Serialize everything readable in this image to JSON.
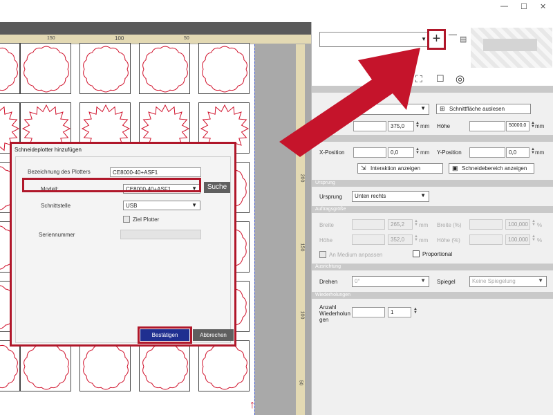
{
  "window": {
    "minimize_icon": "—",
    "maximize_icon": "☐",
    "close_icon": "✕"
  },
  "ruler": {
    "h_labels": [
      "150",
      "100",
      "50"
    ],
    "v_labels": [
      "200",
      "150",
      "100",
      "50"
    ]
  },
  "dialog": {
    "title": "Schneideplotter hinzufügen",
    "plotter_name_label": "Bezeichnung des Plotters",
    "plotter_name_value": "CE8000-40+ASF1",
    "model_label": "Modell:",
    "model_value": "CE8000-40+ASF1",
    "search_label": "Suche",
    "interface_label": "Schnittstelle",
    "interface_value": "USB",
    "target_plotter_label": "Ziel Plotter",
    "serial_label": "Seriennummer",
    "serial_value": "",
    "confirm_label": "Bestätigen",
    "cancel_label": "Abbrechen"
  },
  "panel": {
    "plotter_select_value": "",
    "plus_label": "+",
    "read_cut_area_label": "Schnittfläche auslesen",
    "width_value": "375,0",
    "height_label": "Höhe",
    "height_value": "50000,0",
    "unit_mm": "mm",
    "x_label": "X-Position",
    "x_value": "0,0",
    "y_label": "Y-Position",
    "y_value": "0,0",
    "show_interaction_label": "Interaktion anzeigen",
    "show_cut_area_label": "Schneidebereich anzeigen",
    "sec_origin": "Ursprung",
    "origin_label": "Ursprung",
    "origin_value": "Unten rechts",
    "sec_jobsize": "Auftragsgröße",
    "width_label": "Breite",
    "job_width_value": "265,2",
    "width_pct_label": "Breite (%)",
    "width_pct_value": "100,000",
    "pct": "%",
    "job_height_value": "352,0",
    "height_pct_label": "Höhe (%)",
    "height_pct_value": "100,000",
    "fit_media_label": "An Medium anpassen",
    "proportional_label": "Proportional",
    "sec_orientation": "Ausrichtung",
    "rotate_label": "Drehen",
    "rotate_value": "0°",
    "mirror_label": "Spiegel",
    "mirror_value": "Keine Spiegelung",
    "sec_repeat": "Wiederholungen",
    "repeat_label": "Anzahl Wiederholun gen",
    "repeat_value": "1"
  },
  "colors": {
    "accent_red": "#b0172a",
    "confirm_blue": "#1f2f90",
    "shape_red": "#d0102a"
  }
}
